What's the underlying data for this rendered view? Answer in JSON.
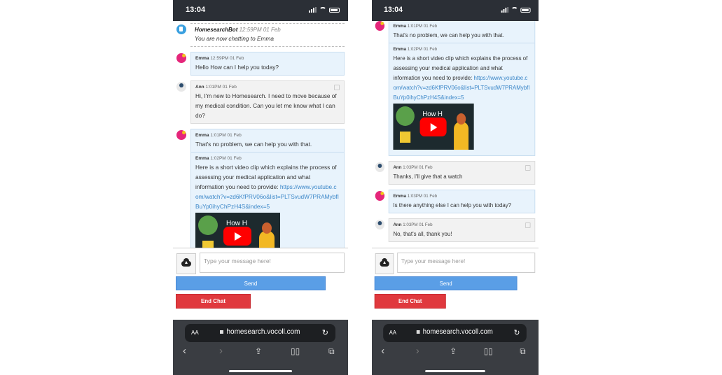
{
  "colors": {
    "agent_bubble": "#e8f3fc",
    "user_bubble": "#f2f2f2",
    "send": "#5a9ee6",
    "end_chat": "#e0393e",
    "link": "#3a86c8"
  },
  "phones": [
    {
      "status": {
        "time": "13:04"
      },
      "chat": [
        {
          "sender": "HomesearchBot",
          "avatar": "bot-icon",
          "role": "bot",
          "items": [
            {
              "time": "12:59PM 01 Feb",
              "text": "You are now chatting to Emma"
            }
          ]
        },
        {
          "sender": "Emma",
          "avatar": "agent-avatar",
          "role": "agent",
          "items": [
            {
              "time": "12:59PM 01 Feb",
              "text": "Hello How can I help you today?"
            }
          ]
        },
        {
          "sender": "Ann",
          "avatar": "user-avatar",
          "role": "user",
          "items": [
            {
              "time": "1:01PM 01 Feb",
              "text": "Hi, I'm new to Homesearch. I need to move because of my medical condition. Can you let me know what I can do?"
            }
          ]
        },
        {
          "sender": "Emma",
          "avatar": "agent-avatar",
          "role": "agent",
          "items": [
            {
              "time": "1:01PM 01 Feb",
              "text": "That's no problem, we can help you with that."
            },
            {
              "time": "1:02PM 01 Feb",
              "text": "Here is a short video clip which explains the process of assessing your medical application and what information you need to provide: ",
              "link": "https://www.youtube.com/watch?v=zd6KfPRV06o&list=PLTSvudW7PRAMybfIBuYp0ihyChPzH4S&index=5",
              "video": {
                "title": "How H",
                "play_icon": "youtube-play-icon"
              }
            }
          ]
        }
      ],
      "compose": {
        "placeholder": "Type your message here!",
        "send": "Send",
        "end_chat": "End Chat"
      },
      "browser": {
        "aa": "AA",
        "url": "homesearch.vocoll.com"
      }
    },
    {
      "status": {
        "time": "13:04"
      },
      "chat": [
        {
          "sender": "Emma",
          "avatar": "agent-avatar",
          "role": "agent",
          "items": [
            {
              "time": "1:01PM 01 Feb",
              "text": "That's no problem, we can help you with that."
            },
            {
              "time": "1:02PM 01 Feb",
              "text": "Here is a short video clip which explains the process of assessing your medical application and what information you need to provide: ",
              "link": "https://www.youtube.com/watch?v=zd6KfPRV06o&list=PLTSvudW7PRAMybfIBuYp0ihyChPzH4S&index=5",
              "video": {
                "title": "How H",
                "play_icon": "youtube-play-icon"
              }
            }
          ]
        },
        {
          "sender": "Ann",
          "avatar": "user-avatar",
          "role": "user",
          "items": [
            {
              "time": "1:03PM 01 Feb",
              "text": "Thanks, I'll give that a watch"
            }
          ]
        },
        {
          "sender": "Emma",
          "avatar": "agent-avatar",
          "role": "agent",
          "items": [
            {
              "time": "1:03PM 01 Feb",
              "text": "Is there anything else I can help you with today?"
            }
          ]
        },
        {
          "sender": "Ann",
          "avatar": "user-avatar",
          "role": "user",
          "items": [
            {
              "time": "1:03PM 01 Feb",
              "text": "No, that's all, thank you!"
            }
          ]
        }
      ],
      "compose": {
        "placeholder": "Type your message here!",
        "send": "Send",
        "end_chat": "End Chat"
      },
      "browser": {
        "aa": "AA",
        "url": "homesearch.vocoll.com"
      }
    }
  ]
}
